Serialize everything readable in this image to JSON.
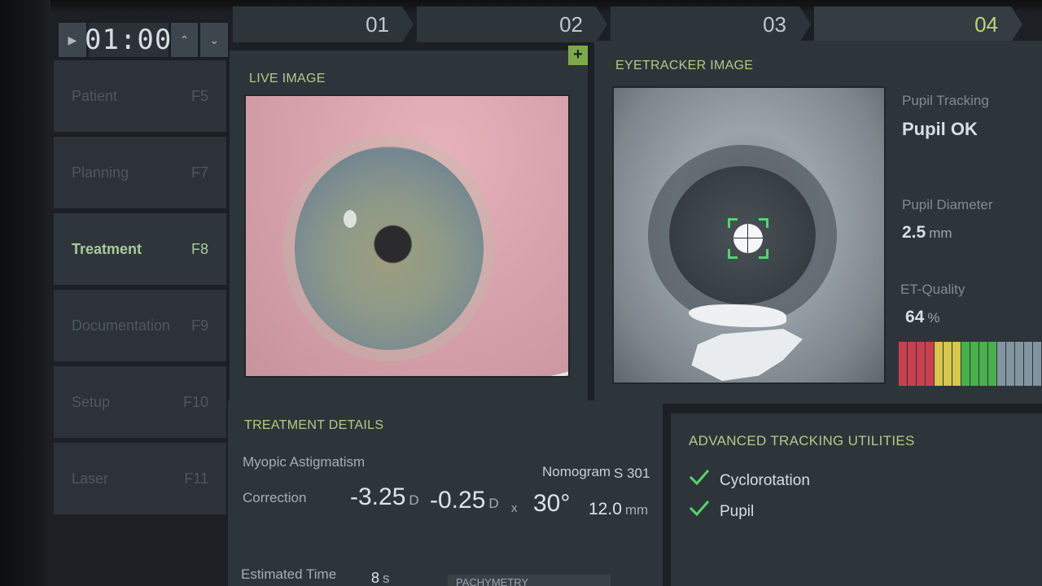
{
  "timer": {
    "play_icon": "play-icon",
    "value": "01:00",
    "up_icon": "chevron-up-icon",
    "down_icon": "chevron-down-icon"
  },
  "steps": [
    {
      "label": "01"
    },
    {
      "label": "02"
    },
    {
      "label": "03"
    },
    {
      "label": "04",
      "active": true
    }
  ],
  "sidebar": {
    "items": [
      {
        "label": "Patient",
        "key": "F5"
      },
      {
        "label": "Planning",
        "key": "F7"
      },
      {
        "label": "Treatment",
        "key": "F8",
        "active": true
      },
      {
        "label": "Documentation",
        "key": "F9"
      },
      {
        "label": "Setup",
        "key": "F10"
      },
      {
        "label": "Laser",
        "key": "F11"
      }
    ]
  },
  "live_image": {
    "title": "LIVE IMAGE",
    "add_icon": "plus-icon"
  },
  "eyetracker": {
    "title": "EYETRACKER IMAGE",
    "pupil_tracking_label": "Pupil Tracking",
    "pupil_tracking_value": "Pupil OK",
    "pupil_diameter_label": "Pupil Diameter",
    "pupil_diameter_value": "2.5",
    "pupil_diameter_unit": "mm",
    "et_quality_label": "ET-Quality",
    "et_quality_value": "64",
    "et_quality_unit": "%",
    "et_quality_fraction": 0.64,
    "quality_colors": [
      "#c9414f",
      "#c9414f",
      "#c9414f",
      "#c9414f",
      "#d6c64c",
      "#d6c64c",
      "#d6c64c",
      "#49b04d",
      "#49b04d",
      "#49b04d",
      "#49b04d",
      "#8294a0",
      "#8294a0",
      "#8294a0",
      "#8294a0",
      "#8294a0"
    ]
  },
  "treatment_details": {
    "title": "TREATMENT DETAILS",
    "diagnosis": "Myopic Astigmatism",
    "nomogram_label": "Nomogram",
    "nomogram_value": "S 301",
    "correction_label": "Correction",
    "sphere_value": "-3.25",
    "sphere_unit": "D",
    "cylinder_value": "-0.25",
    "cylinder_unit": "D",
    "axis_separator": "x",
    "axis_value": "30°",
    "optical_zone_value": "12.0",
    "optical_zone_unit": "mm",
    "estimated_time_label": "Estimated Time",
    "estimated_time_value": "8",
    "estimated_time_unit": "s",
    "pachymetry_label": "PACHYMETRY"
  },
  "advanced_tracking": {
    "title": "ADVANCED TRACKING UTILITIES",
    "items": [
      {
        "label": "Cyclorotation",
        "icon": "check-icon"
      },
      {
        "label": "Pupil",
        "icon": "check-icon"
      }
    ]
  },
  "colors": {
    "accent_green": "#b3c98a",
    "check_green": "#55d46b",
    "panel_bg": "#2e353a"
  }
}
